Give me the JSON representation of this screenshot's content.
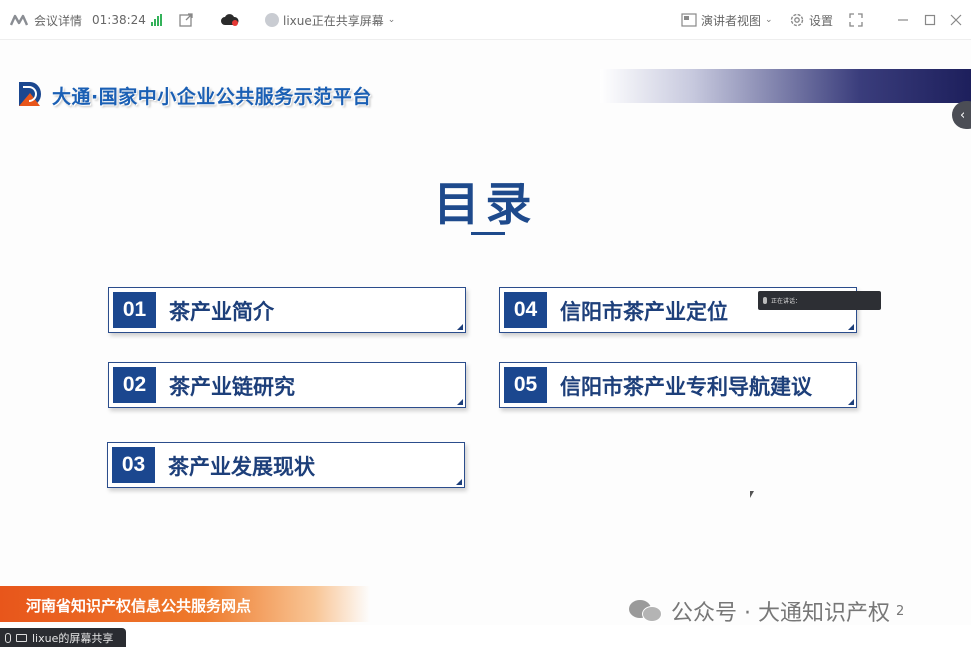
{
  "toolbar": {
    "meeting_info_label": "会议详情",
    "timer": "01:38:24",
    "sharing_status": "lixue正在共享屏幕",
    "presenter_view_label": "演讲者视图",
    "settings_label": "设置"
  },
  "slide": {
    "brand_title": "大通·国家中小企业公共服务示范平台",
    "toc_title": "目录",
    "items": [
      {
        "num": "01",
        "label": "茶产业简介"
      },
      {
        "num": "02",
        "label": "茶产业链研究"
      },
      {
        "num": "03",
        "label": "茶产业发展现状"
      },
      {
        "num": "04",
        "label": "信阳市茶产业定位"
      },
      {
        "num": "05",
        "label": "信阳市茶产业专利导航建议"
      }
    ],
    "mini_overlay_text": "正在讲话：",
    "footer_text": "河南省知识产权信息公共服务网点",
    "watermark_text": "公众号 · 大通知识产权",
    "watermark_page": "2"
  },
  "share_chip": {
    "label": "lixue的屏幕共享"
  },
  "colors": {
    "accent_blue": "#1b478f",
    "footer_orange": "#e8561b",
    "signal_green": "#34b25a"
  }
}
